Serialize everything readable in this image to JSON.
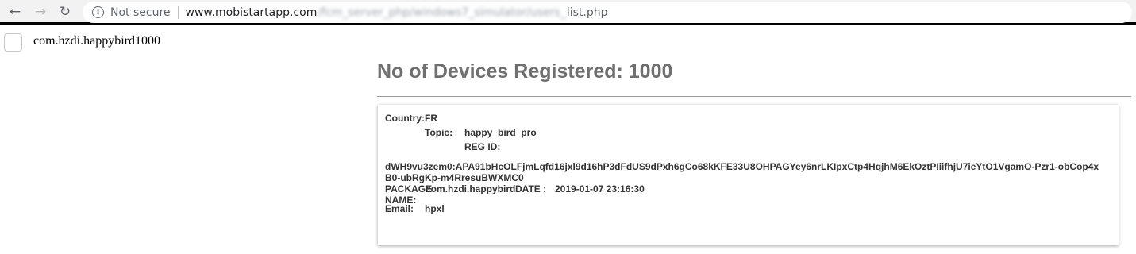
{
  "browser": {
    "back_icon": "←",
    "forward_icon": "→",
    "reload_icon": "↻",
    "info_icon": "i",
    "security_label": "Not secure",
    "url_host": "www.mobistartapp.com",
    "url_blurred": "/fcm_server_php/windows7_simulator/users_",
    "url_end": "list.php"
  },
  "app": {
    "package_label": "com.hzdi.happybird1000"
  },
  "main": {
    "heading": "No of Devices Registered: 1000"
  },
  "device": {
    "country_label": "Country:",
    "country_value": "FR",
    "topic_label": "Topic:",
    "topic_value": "happy_bird_pro",
    "regid_label": "REG ID:",
    "regid_value": "dWH9vu3zem0:APA91bHcOLFjmLqfd16jxl9d16hP3dFdUS9dPxh6gCo68kKFE33U8OHPAGYey6nrLKIpxCtp4HqjhM6EkOztPIiifhjU7ieYtO1VgamO-Pzr1-obCop4xB0-ubRgKp-m4RresuBWXMC0",
    "package_name_label_1": "PACKAGE",
    "package_name_label_2": "NAME:",
    "package_value": "com.hzdi.happybird",
    "date_label": "DATE :",
    "date_value": "2019-01-07 23:16:30",
    "email_label": "Email:",
    "email_value": "hpxl"
  }
}
